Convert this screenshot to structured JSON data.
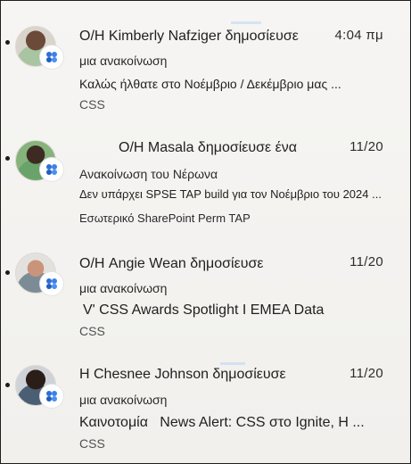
{
  "notifications": [
    {
      "author_line": "Ο/Η Kimberly Nafziger δημοσίευσε",
      "time": "4:04 πμ",
      "type_line": "μια ανακοίνωση",
      "preview": "Καλώς ήλθατε στο Νοέμβριο / Δεκέμβριο μας ...",
      "tag": "CSS",
      "unread": true
    },
    {
      "author_line": "Ο/Η Masala δημοσίευσε ένα",
      "time": "11/20",
      "type_line": "Ανακοίνωση του Νέρωνα",
      "preview": "Δεν υπάρχει SPSE TAP build για τον Νοέμβριο του 2024 ...",
      "tag": "Εσωτερικό SharePoint Perm TAP",
      "unread": true
    },
    {
      "author_line": "Ο/Η Angie Wean δημοσίευσε",
      "time": "11/20",
      "type_line": "μια ανακοίνωση",
      "preview": "V' CSS Awards Spotlight I EMEA Data",
      "tag": "CSS",
      "unread": true
    },
    {
      "author_line": "Η Chesnee Johnson δημοσίευσε",
      "time": "11/20",
      "type_line": "μια ανακοίνωση",
      "preview": "Καινοτομία   News Alert: CSS στο Ignite, Η ...",
      "tag": "CSS",
      "unread": true
    }
  ],
  "colors": {
    "badge_blue": "#2f6fd6",
    "unread_dot": "#1b1b1b"
  }
}
